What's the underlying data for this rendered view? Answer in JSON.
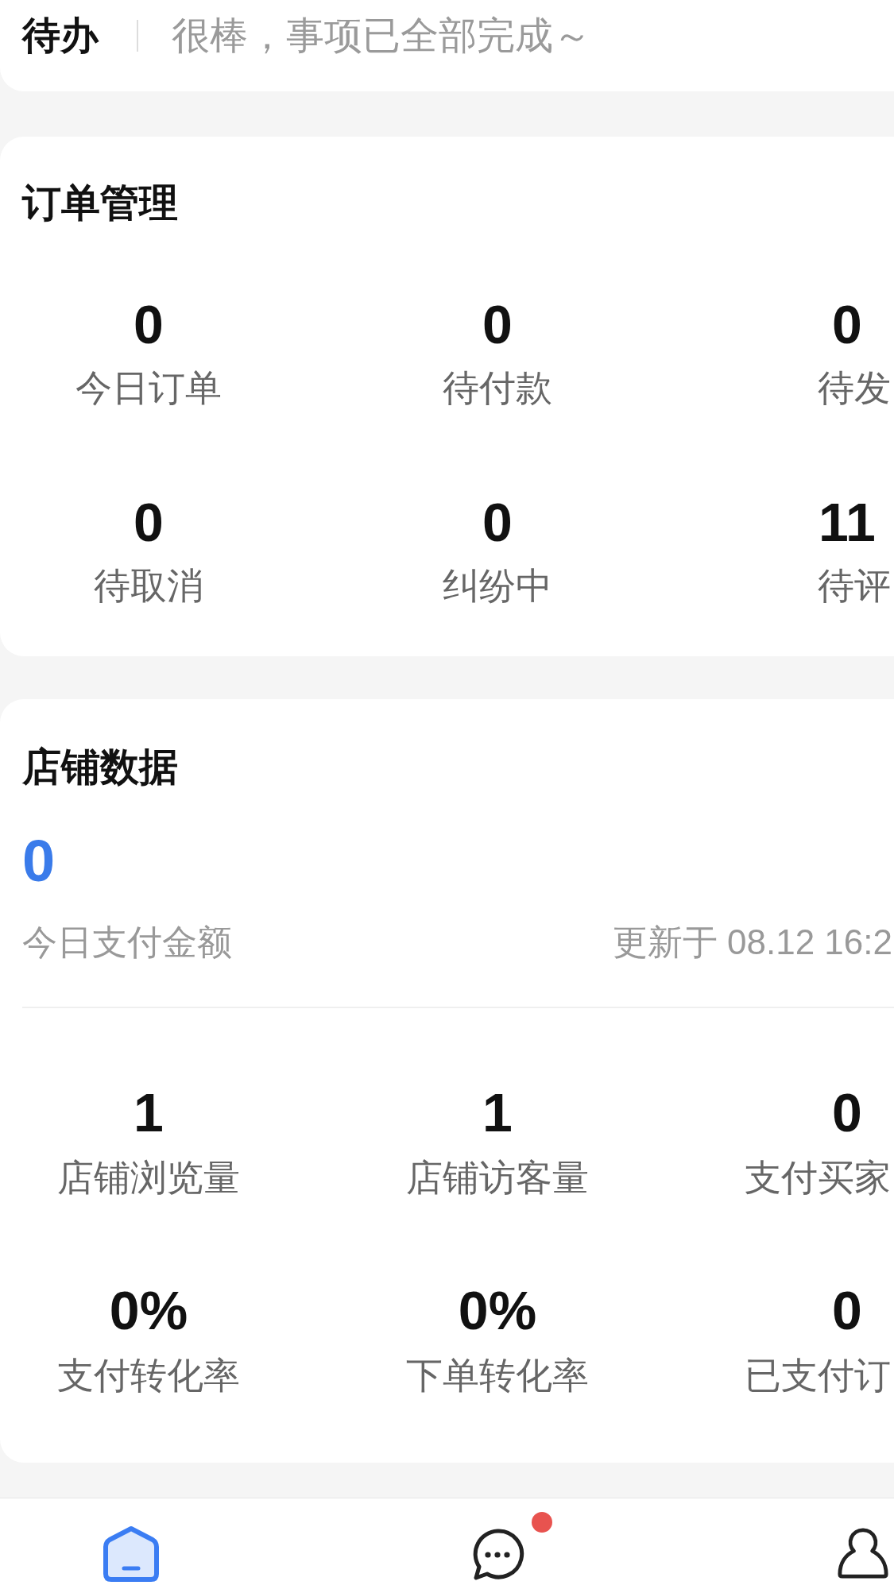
{
  "todo": {
    "title": "待办",
    "message": "很棒，事项已全部完成～"
  },
  "order_management": {
    "title": "订单管理",
    "stats": [
      {
        "value": "0",
        "label": "今日订单"
      },
      {
        "value": "0",
        "label": "待付款"
      },
      {
        "value": "0",
        "label": "待发"
      },
      {
        "value": "0",
        "label": "待取消"
      },
      {
        "value": "0",
        "label": "纠纷中"
      },
      {
        "value": "11",
        "label": "待评"
      }
    ]
  },
  "store_data": {
    "title": "店铺数据",
    "highlight": {
      "value": "0",
      "label": "今日支付金额",
      "updated": "更新于 08.12 16:2"
    },
    "stats": [
      {
        "value": "1",
        "label": "店铺浏览量"
      },
      {
        "value": "1",
        "label": "店铺访客量"
      },
      {
        "value": "0",
        "label": "支付买家"
      },
      {
        "value": "0%",
        "label": "支付转化率"
      },
      {
        "value": "0%",
        "label": "下单转化率"
      },
      {
        "value": "0",
        "label": "已支付订"
      }
    ]
  },
  "bottom_nav": [
    {
      "kind": "home",
      "selected": true,
      "badge": false
    },
    {
      "kind": "messages",
      "selected": false,
      "badge": true
    },
    {
      "kind": "profile",
      "selected": false,
      "badge": false
    }
  ]
}
